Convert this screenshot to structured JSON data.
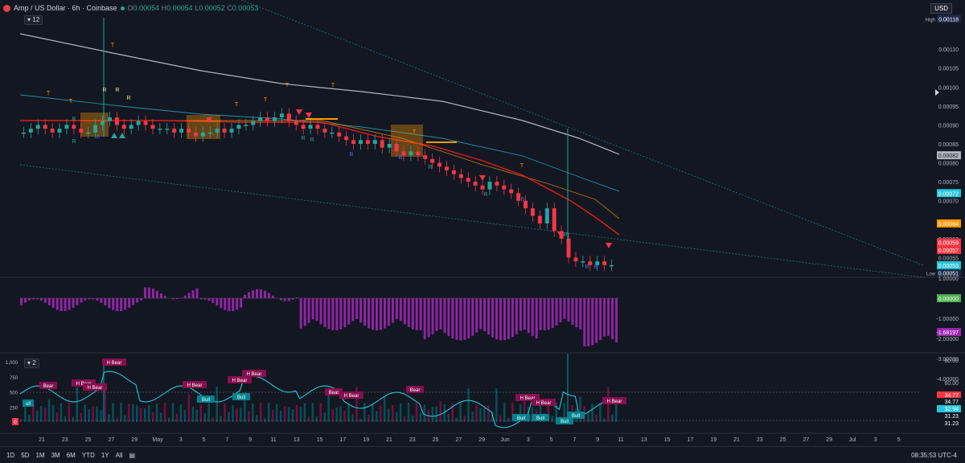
{
  "header": {
    "symbol": "Amp / US Dollar · 6h · Coinbase",
    "o_label": "O",
    "o": "0.00054",
    "h_label": "H",
    "h": "0.00054",
    "l_label": "L",
    "l": "0.00052",
    "c_label": "C",
    "c": "0.00053",
    "indicator_count": "12",
    "currency": "USD"
  },
  "price_axis": {
    "ticks": [
      "0.00110",
      "0.00105",
      "0.00100",
      "0.00095",
      "0.00090",
      "0.00085",
      "0.00080",
      "0.00075",
      "0.00070",
      "0.00060",
      "0.00055"
    ],
    "high": {
      "label": "High",
      "value": "0.00118"
    },
    "low": {
      "label": "Low",
      "value": "0.00051"
    },
    "badges": [
      {
        "value": "0.00082",
        "color": "#b2b5be"
      },
      {
        "value": "0.00072",
        "color": "#26c6da"
      },
      {
        "value": "0.00064",
        "color": "#ff9800"
      },
      {
        "value": "0.00059",
        "color": "#f23645"
      },
      {
        "value": "0.00057",
        "color": "#f23645"
      },
      {
        "value": "0.00053",
        "color": "#26c6da"
      }
    ]
  },
  "osc_axis": {
    "ticks": [
      "1.00000",
      "-1.00000",
      "-2.00000",
      "-3.00000",
      "-4.00000"
    ],
    "badges": [
      {
        "value": "0.00000",
        "color": "#4caf50"
      },
      {
        "value": "-1.68197",
        "color": "#9c27b0"
      }
    ]
  },
  "rsi_axis": {
    "ticks": [
      "80.00",
      "60.00"
    ],
    "badges": [
      {
        "value": "34.77",
        "color": "#f23645"
      },
      {
        "value": "34.77",
        "color": "#131722"
      },
      {
        "value": "32.94",
        "color": "#26c6da"
      },
      {
        "value": "31.23",
        "color": "#131722"
      },
      {
        "value": "31.23",
        "color": "#131722"
      }
    ],
    "indicator_count": "2"
  },
  "volume_axis": {
    "ticks": [
      "1,000",
      "750",
      "500",
      "250",
      "0"
    ]
  },
  "x_axis": {
    "labels": [
      "21",
      "23",
      "25",
      "27",
      "29",
      "May",
      "3",
      "5",
      "7",
      "9",
      "11",
      "13",
      "15",
      "17",
      "19",
      "21",
      "23",
      "25",
      "27",
      "29",
      "Jun",
      "3",
      "5",
      "7",
      "9",
      "11",
      "13",
      "15",
      "17",
      "19",
      "21",
      "23",
      "25",
      "27",
      "29",
      "Jul",
      "3",
      "5"
    ]
  },
  "colors": {
    "bg": "#131722",
    "up": "#26a69a",
    "down": "#f23645",
    "ma_white": "#b2b5be",
    "ma_teal": "#26c6da",
    "ma_red": "#e31b1b",
    "ma_orange": "#ff9800",
    "osc": "#9c27b0",
    "rsi": "#26c6da"
  },
  "chart_data": [
    {
      "type": "candlestick",
      "title": "Amp / US Dollar · 6h · Coinbase",
      "ylim": [
        0.0005,
        0.0012
      ],
      "close": [
        0.00088,
        0.00089,
        0.0009,
        0.00089,
        0.00088,
        0.00089,
        0.0009,
        0.00089,
        0.00088,
        0.00088,
        0.0009,
        0.00091,
        0.00092,
        0.0009,
        0.00089,
        0.0009,
        0.00091,
        0.0009,
        0.00089,
        0.00089,
        0.00089,
        0.00088,
        0.00089,
        0.00088,
        0.00087,
        0.00088,
        0.00088,
        0.00089,
        0.00088,
        0.00089,
        0.0009,
        0.0009,
        0.00091,
        0.00092,
        0.00091,
        0.00092,
        0.00093,
        0.00091,
        0.0009,
        0.00089,
        0.0009,
        0.00089,
        0.00088,
        0.00088,
        0.00087,
        0.00086,
        0.00085,
        0.00086,
        0.00085,
        0.00086,
        0.00084,
        0.00085,
        0.00083,
        0.00082,
        0.00083,
        0.00082,
        0.00081,
        0.0008,
        0.00079,
        0.00078,
        0.00077,
        0.00076,
        0.00075,
        0.00074,
        0.00073,
        0.00075,
        0.00074,
        0.00073,
        0.00072,
        0.0007,
        0.00068,
        0.00066,
        0.00064,
        0.00068,
        0.00062,
        0.0006,
        0.00055,
        0.00054,
        0.00054,
        0.00053,
        0.00054,
        0.00053,
        0.00053
      ]
    },
    {
      "type": "bar",
      "name": "oscillator",
      "ylim": [
        -4,
        1.5
      ],
      "values_last": -1.68197
    },
    {
      "type": "line",
      "name": "RSI",
      "last": 32.94,
      "labels": [
        "Bear",
        "H Bear",
        "H Bear",
        "H Bear",
        "H Bear",
        "H Bear",
        "H Bear",
        "Bull",
        "Bull",
        "H Bear",
        "H Bear",
        "Bear",
        "H Bear",
        "H Bear",
        "Bull",
        "Bull",
        "Bull",
        "Bull",
        "H Bear"
      ]
    }
  ]
}
